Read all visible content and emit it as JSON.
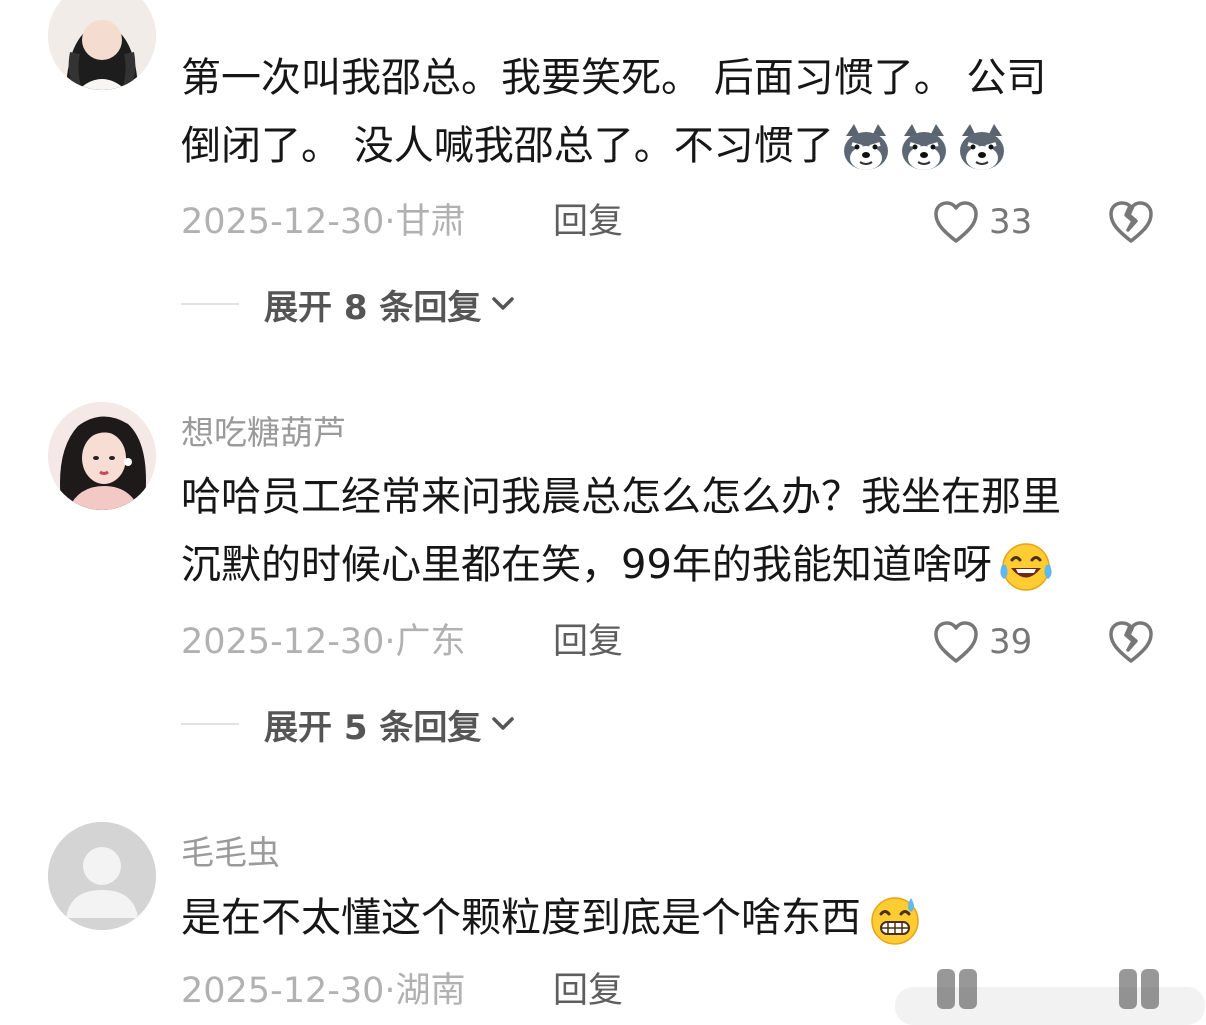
{
  "comments": [
    {
      "username": "",
      "text_line1": "第一次叫我邵总。我要笑死。 后面习惯了。 公司",
      "text_line2": "倒闭了。 没人喊我邵总了。不习惯了",
      "emojis": [
        "husky-smirk-emoji",
        "husky-smirk-emoji",
        "husky-smirk-emoji"
      ],
      "date": "2025-12-30",
      "location": "甘肃",
      "reply_label": "回复",
      "likes": "33",
      "expand_label": "展开 8 条回复"
    },
    {
      "username": "想吃糖葫芦",
      "text_line1": "哈哈员工经常来问我晨总怎么怎么办？我坐在那里",
      "text_line2": "沉默的时候心里都在笑，99年的我能知道啥呀",
      "emojis": [
        "tears-of-joy-emoji"
      ],
      "date": "2025-12-30",
      "location": "广东",
      "reply_label": "回复",
      "likes": "39",
      "expand_label": "展开 5 条回复"
    },
    {
      "username": "毛毛虫",
      "text_line1": "是在不太懂这个颗粒度到底是个啥东西",
      "emojis": [
        "grimacing-sweat-emoji"
      ],
      "date": "2025-12-30",
      "location": "湖南",
      "reply_label": "回复"
    }
  ],
  "icons": {
    "like": "heart-outline-icon",
    "dislike": "broken-heart-icon",
    "expand": "chevron-down-icon"
  },
  "colors": {
    "text": "#161616",
    "meta": "#b1b1b1",
    "username": "#9a9a9a",
    "reply": "#5e5e5e"
  }
}
